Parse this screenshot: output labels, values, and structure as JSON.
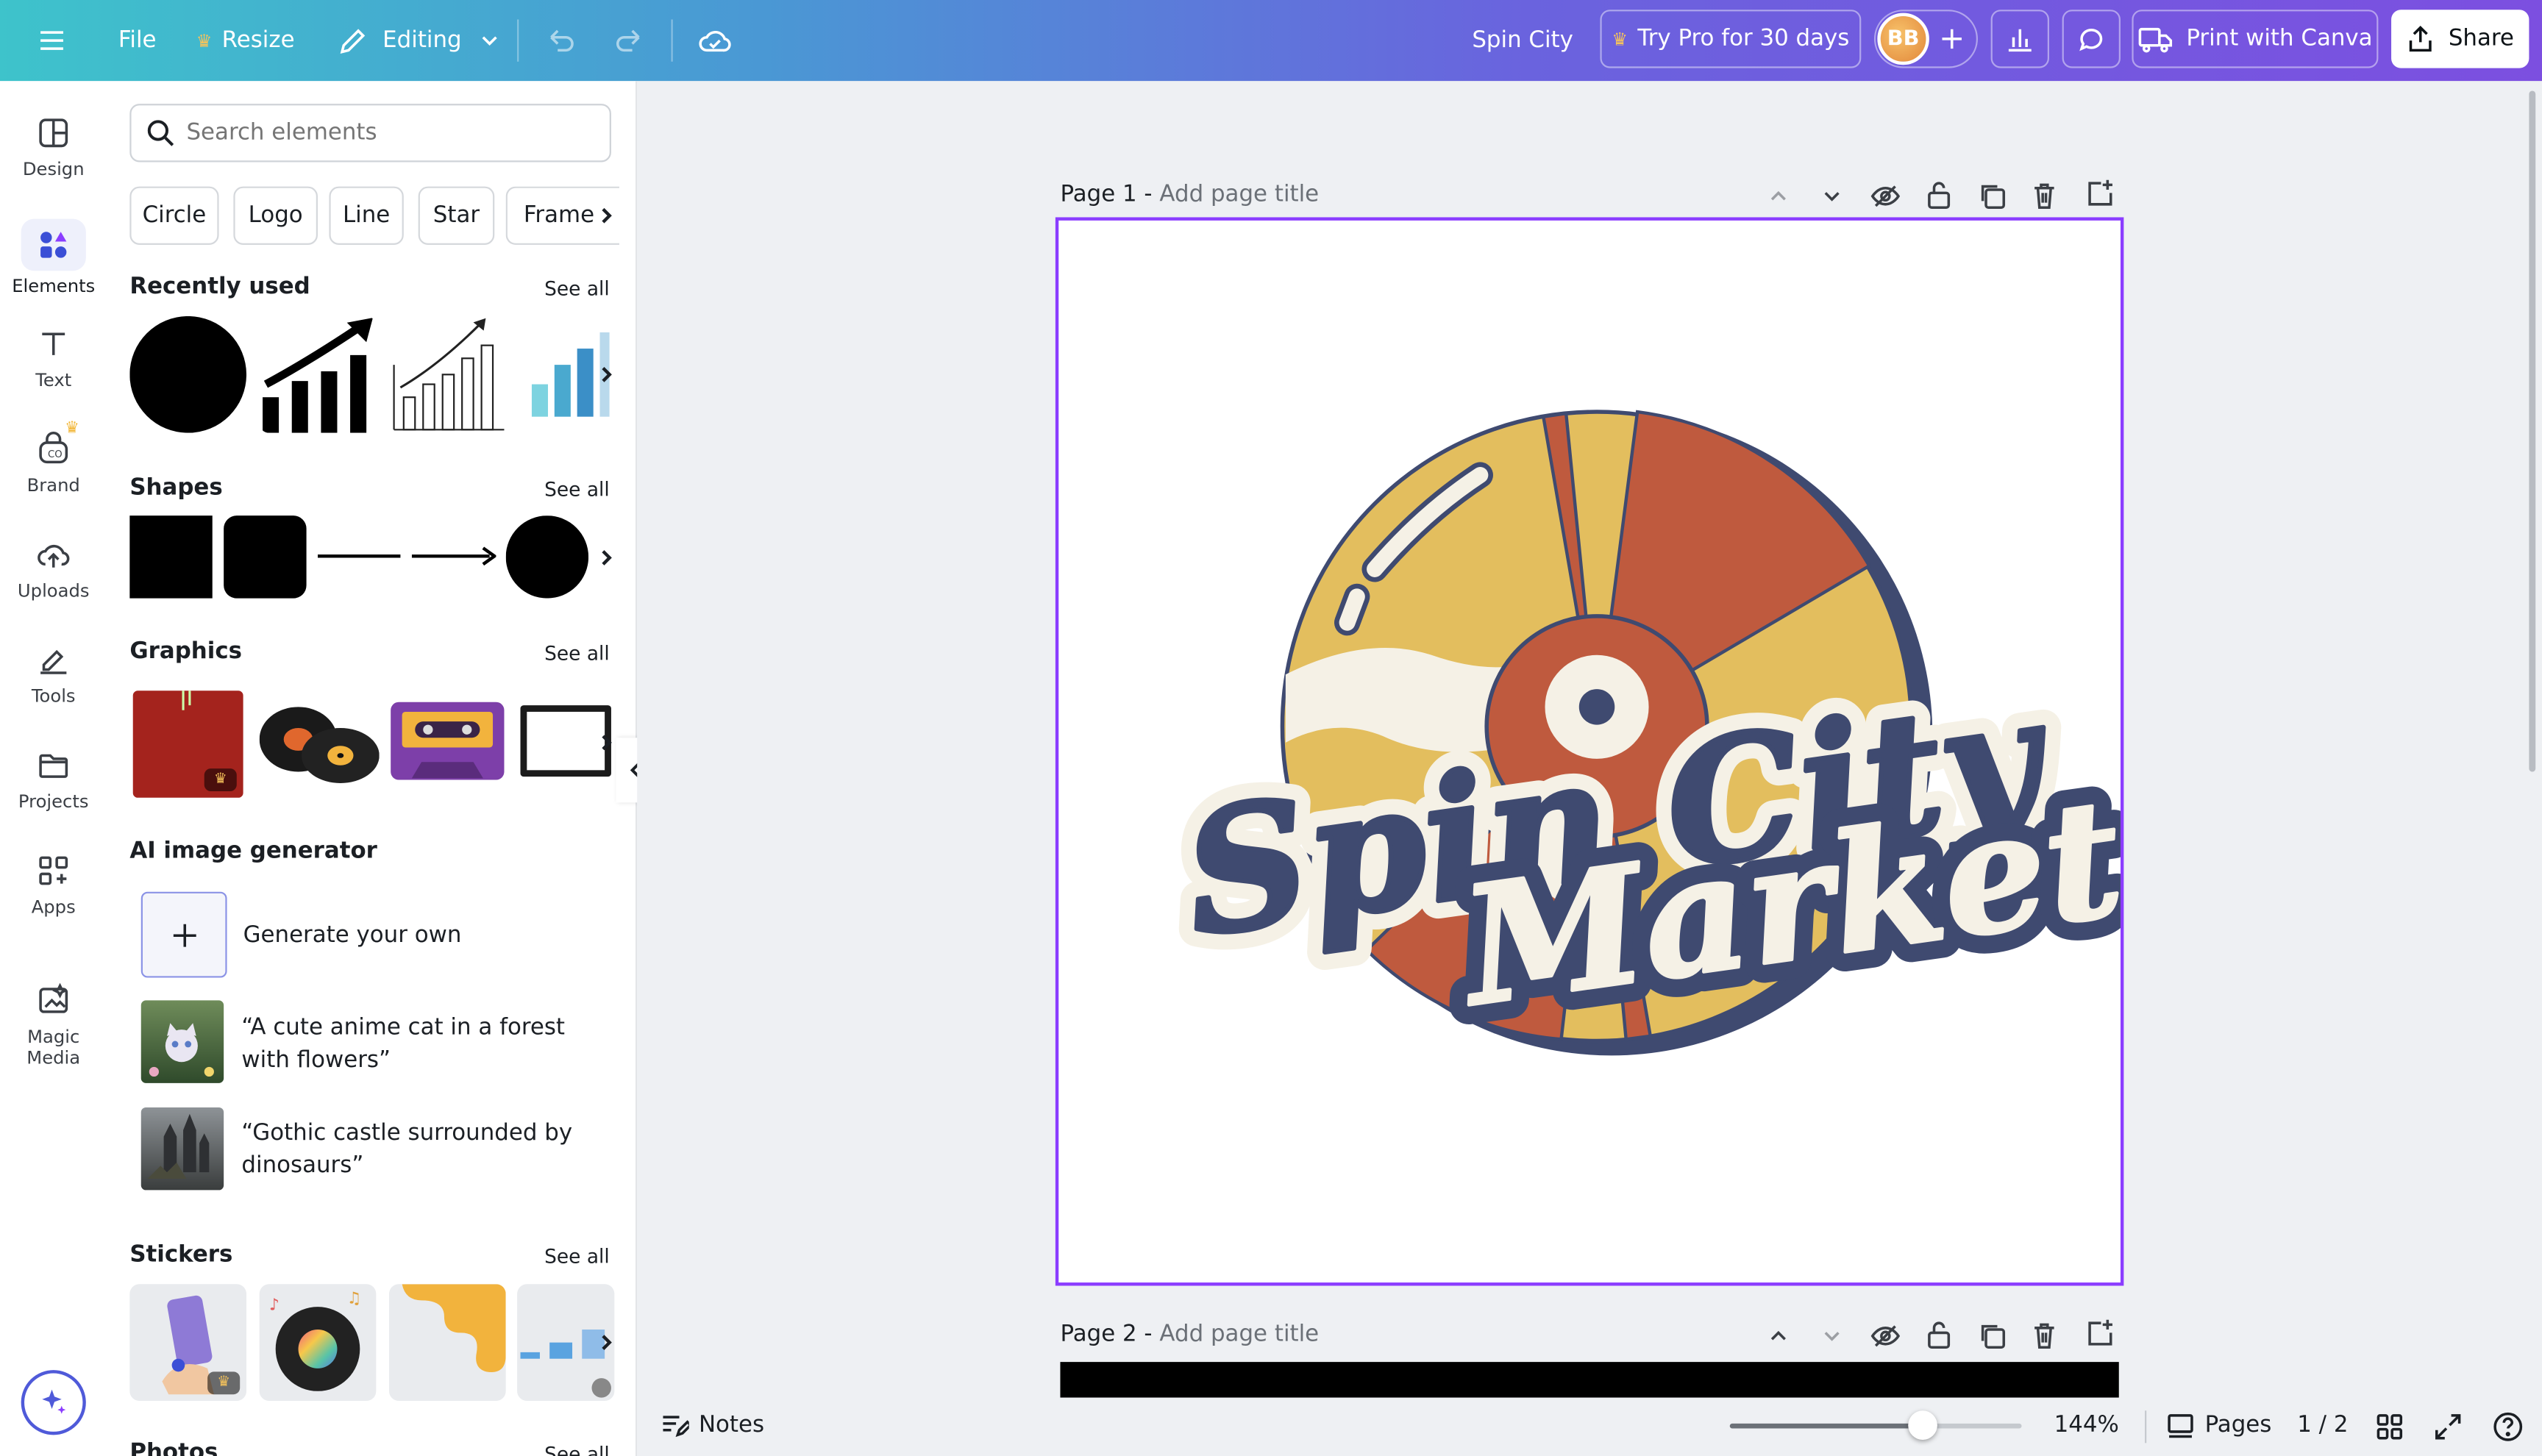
{
  "topbar": {
    "file": "File",
    "resize": "Resize",
    "editing": "Editing",
    "doc_title": "Spin City",
    "try_pro": "Try Pro for 30 days",
    "avatar_initials": "BB",
    "print": "Print with Canva",
    "share": "Share"
  },
  "rail": [
    {
      "label": "Design"
    },
    {
      "label": "Elements"
    },
    {
      "label": "Text"
    },
    {
      "label": "Brand"
    },
    {
      "label": "Uploads"
    },
    {
      "label": "Tools"
    },
    {
      "label": "Projects"
    },
    {
      "label": "Apps"
    },
    {
      "label": "Magic Media"
    }
  ],
  "panel": {
    "search_placeholder": "Search elements",
    "chips": [
      "Circle",
      "Logo",
      "Line",
      "Star",
      "Frame"
    ],
    "recently_used": "Recently used",
    "shapes": "Shapes",
    "graphics": "Graphics",
    "ai_generator": "AI image generator",
    "generate_own": "Generate your own",
    "prompt1": "“A cute anime cat in a forest with flowers”",
    "prompt2": "“Gothic castle surrounded by dinosaurs”",
    "stickers": "Stickers",
    "photos": "Photos",
    "see_all": "See all"
  },
  "canvas": {
    "page1_label": "Page 1 -",
    "page1_placeholder": "Add page title",
    "page2_label": "Page 2 -",
    "page2_placeholder": "Add page title",
    "logo_line1": "Spin City",
    "logo_line2": "Market"
  },
  "bottom": {
    "notes": "Notes",
    "zoom": "144%",
    "pages": "Pages",
    "page_count": "1 / 2",
    "zoom_fraction": 0.66
  },
  "colors": {
    "accent": "#8b3dff",
    "mustard": "#e3be5e",
    "rust": "#bf5a3e",
    "navy": "#3f4a70",
    "cream": "#f5f1e6"
  }
}
